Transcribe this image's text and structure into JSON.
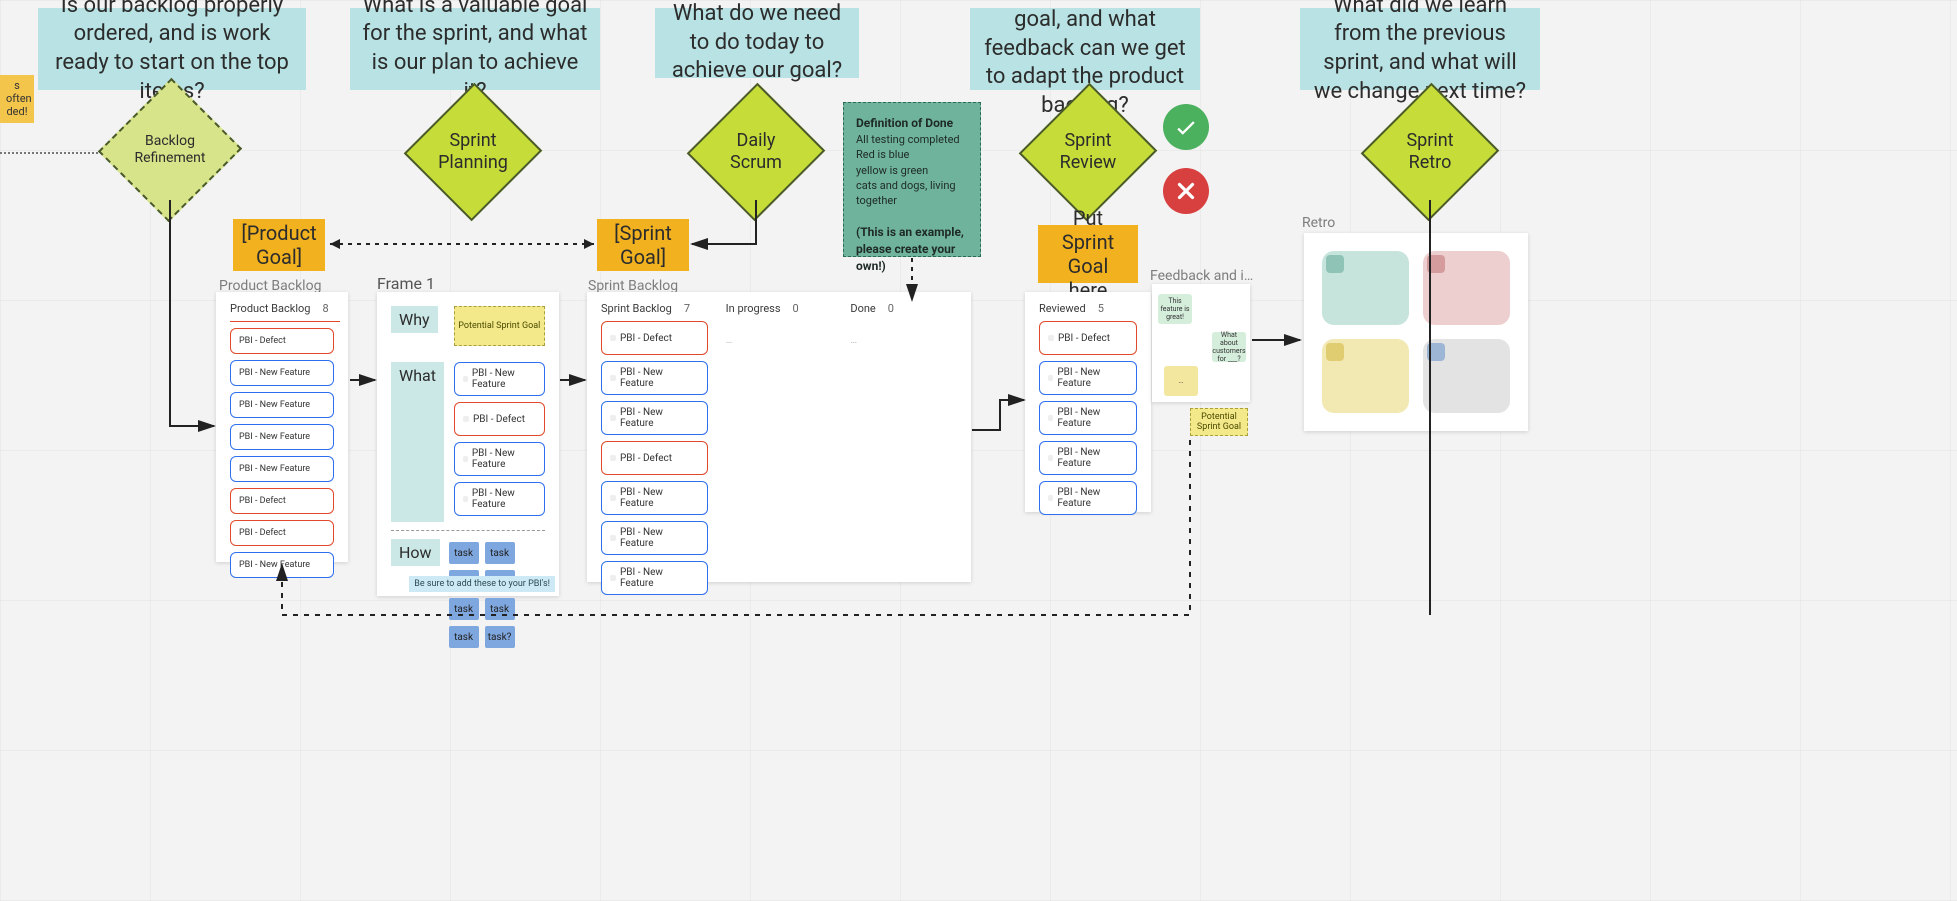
{
  "questions": {
    "refinement": "Is our backlog properly ordered, and is work ready to start on the top items?",
    "planning": "What is a valuable goal for the sprint, and what is our plan to achieve it?",
    "daily": "What do we need to do today\nto achieve our goal?",
    "review": "Did we achieve our goal, and what feedback can we get to adapt the product backlog?",
    "retro": "What did we learn from the previous sprint, and what will we change next time?"
  },
  "diamonds": {
    "refinement": "Backlog\nRefinement",
    "planning": "Sprint\nPlanning",
    "daily": "Daily\nScrum",
    "review": "Sprint\nReview",
    "retro": "Sprint\nRetro"
  },
  "goals": {
    "product": "[Product\nGoal]",
    "sprint": "[Sprint\nGoal]",
    "review_goal": "Put Sprint\nGoal here"
  },
  "side_note": "s often\nded!",
  "panels": {
    "product_backlog_title": "Product Backlog",
    "frame1_title": "Frame 1",
    "sprint_backlog_title": "Sprint Backlog",
    "feedback_title": "Feedback and i…",
    "retro_title": "Retro"
  },
  "frame1": {
    "why": "Why",
    "what": "What",
    "how": "How",
    "potential": "Potential Sprint Goal",
    "tasks_row1": [
      "task",
      "task",
      "task",
      "task?"
    ],
    "tasks_row2": [
      "task",
      "task",
      "task",
      "task?"
    ],
    "hint": "Be sure to add these to your PBI's!",
    "items": [
      {
        "text": "PBI - New Feature",
        "type": "feature"
      },
      {
        "text": "PBI - Defect",
        "type": "defect"
      },
      {
        "text": "PBI - New Feature",
        "type": "feature"
      },
      {
        "text": "PBI - New Feature",
        "type": "feature"
      }
    ]
  },
  "product_backlog": {
    "header": "Product Backlog",
    "count": "8",
    "items": [
      {
        "text": "PBI - Defect",
        "type": "defect"
      },
      {
        "text": "PBI - New Feature",
        "type": "feature"
      },
      {
        "text": "PBI - New Feature",
        "type": "feature"
      },
      {
        "text": "PBI - New Feature",
        "type": "feature"
      },
      {
        "text": "PBI - New Feature",
        "type": "feature"
      },
      {
        "text": "PBI - Defect",
        "type": "defect"
      },
      {
        "text": "PBI - Defect",
        "type": "defect"
      },
      {
        "text": "PBI - New Feature",
        "type": "feature"
      }
    ]
  },
  "sprint_board": {
    "cols": [
      {
        "name": "Sprint Backlog",
        "count": "7",
        "items": [
          {
            "text": "PBI - Defect",
            "type": "defect"
          },
          {
            "text": "PBI - New Feature",
            "type": "feature"
          },
          {
            "text": "PBI - New Feature",
            "type": "feature"
          },
          {
            "text": "PBI - Defect",
            "type": "defect"
          },
          {
            "text": "PBI - New Feature",
            "type": "feature"
          },
          {
            "text": "PBI - New Feature",
            "type": "feature"
          },
          {
            "text": "PBI - New Feature",
            "type": "feature"
          }
        ]
      },
      {
        "name": "In progress",
        "count": "0",
        "items": []
      },
      {
        "name": "Done",
        "count": "0",
        "items": []
      }
    ]
  },
  "reviewed": {
    "header": "Reviewed",
    "count": "5",
    "items": [
      {
        "text": "PBI - Defect",
        "type": "defect"
      },
      {
        "text": "PBI - New Feature",
        "type": "feature"
      },
      {
        "text": "PBI - New Feature",
        "type": "feature"
      },
      {
        "text": "PBI - New Feature",
        "type": "feature"
      },
      {
        "text": "PBI - New Feature",
        "type": "feature"
      }
    ]
  },
  "dod": {
    "title": "Definition of Done",
    "l1": "All testing completed",
    "l2": "Red is blue",
    "l3": "yellow is green",
    "l4": "cats and dogs, living together",
    "note": "(This is an example, please create your own!)"
  },
  "feedback": {
    "n1": "This feature is great!",
    "n2": "What about customers for ___?",
    "n3": "…",
    "potential": "Potential Sprint Goal"
  },
  "colors": {
    "question_bg": "#b8e2e3",
    "diamond_bg": "#c6dc38",
    "goal_bg": "#f2b21f",
    "task_bg": "#7fa7df",
    "dod_bg": "#6fb39c",
    "ok": "#4cb15e",
    "no": "#d83f3f"
  }
}
